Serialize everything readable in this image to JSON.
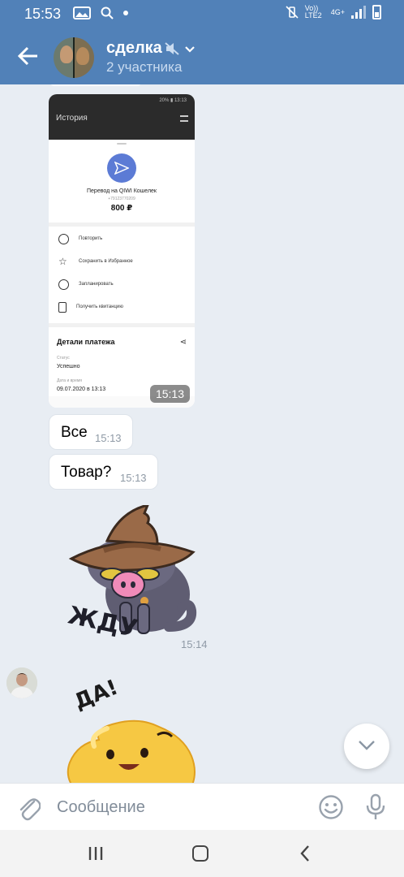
{
  "status_bar": {
    "time": "15:53",
    "network_label": "Vo)) LTE2",
    "network_type": "4G+"
  },
  "header": {
    "title": "сделка",
    "subtitle": "2 участника"
  },
  "photo_message": {
    "screen_status": "20% ▮ 13:13",
    "screen_title": "История",
    "transfer_title": "Перевод на QIWI Кошелек",
    "phone": "+79123770209",
    "amount": "800 ₽",
    "actions": [
      "Повторить",
      "Сохранить в Избранное",
      "Запланировать",
      "Получить квитанцию"
    ],
    "details_title": "Детали платежа",
    "status_label": "Статус",
    "status_value": "Успешно",
    "date_label": "Дата и время",
    "date_value": "09.07.2020 в 13:13",
    "time": "15:13"
  },
  "messages": [
    {
      "text": "Все",
      "time": "15:13"
    },
    {
      "text": "Товар?",
      "time": "15:13"
    }
  ],
  "stickers": {
    "cat_time": "15:14"
  },
  "composer": {
    "placeholder": "Сообщение"
  },
  "colors": {
    "header_bg": "#5181b8",
    "chat_bg": "#e8edf3",
    "accent": "#5181b8"
  },
  "icons": [
    "back-arrow-icon",
    "mute-icon",
    "chevron-down-icon",
    "attach-icon",
    "emoji-icon",
    "mic-icon",
    "scroll-down-icon"
  ]
}
